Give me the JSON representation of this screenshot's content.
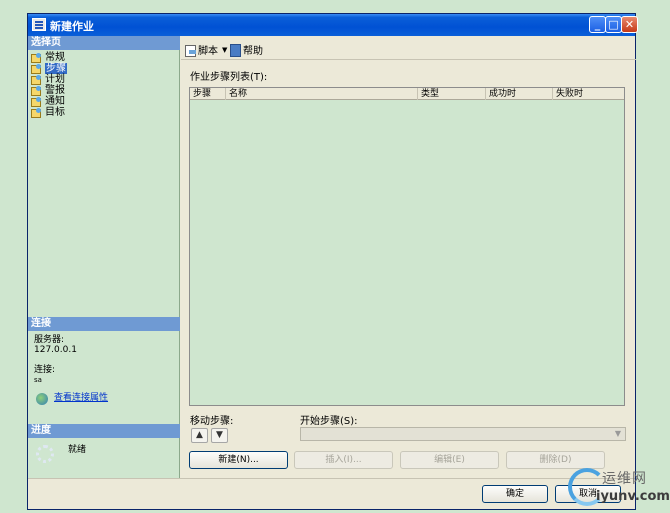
{
  "window": {
    "title": "新建作业"
  },
  "left": {
    "select_page_header": "选择页",
    "pages": [
      {
        "label": "常规"
      },
      {
        "label": "步骤",
        "selected": true
      },
      {
        "label": "计划"
      },
      {
        "label": "警报"
      },
      {
        "label": "通知"
      },
      {
        "label": "目标"
      }
    ],
    "connection_header": "连接",
    "server_label": "服务器:",
    "server_value": "127.0.0.1",
    "connection_label": "连接:",
    "connection_value": "sa",
    "view_conn_props_link": "查看连接属性",
    "progress_header": "进度",
    "progress_status": "就绪"
  },
  "toolbar": {
    "script_label": "脚本",
    "help_label": "帮助"
  },
  "main": {
    "list_label": "作业步骤列表(T):",
    "columns": [
      "步骤",
      "名称",
      "类型",
      "成功时",
      "失败时"
    ],
    "move_step_label": "移动步骤:",
    "start_step_label": "开始步骤(S):",
    "buttons": {
      "new": "新建(N)...",
      "insert": "插入(I)...",
      "edit": "编辑(E)",
      "delete": "删除(D)"
    }
  },
  "footer": {
    "ok": "确定",
    "cancel": "取消"
  },
  "watermark": {
    "text": "运维网",
    "url": "iyunv.com"
  }
}
